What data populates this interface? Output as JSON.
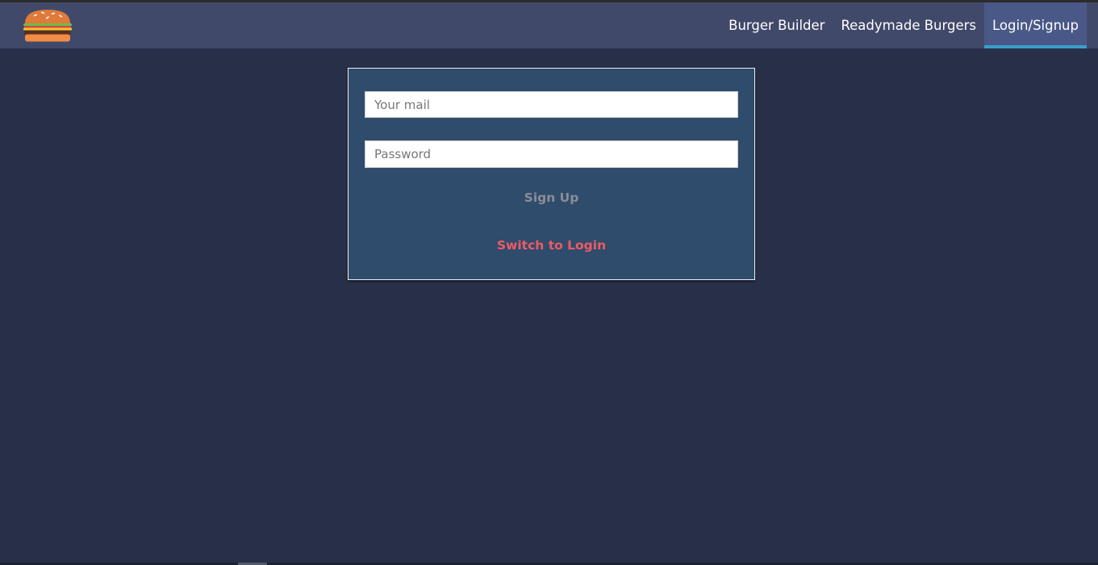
{
  "nav": {
    "logo_icon": "burger-icon",
    "items": [
      {
        "label": "Burger Builder"
      },
      {
        "label": "Readymade Burgers"
      },
      {
        "label": "Login/Signup"
      }
    ],
    "active_index": 2
  },
  "form": {
    "email_placeholder": "Your mail",
    "email_value": "",
    "password_placeholder": "Password",
    "password_value": "",
    "submit_label": "Sign Up",
    "switch_label": "Switch to Login"
  },
  "colors": {
    "background": "#283049",
    "navbar": "#41496a",
    "active_tab": "#4a5887",
    "active_indicator": "#3a9fc8",
    "card": "#2f4c6c",
    "submit_text": "#8a8e96",
    "switch_text": "#ee5a63"
  }
}
